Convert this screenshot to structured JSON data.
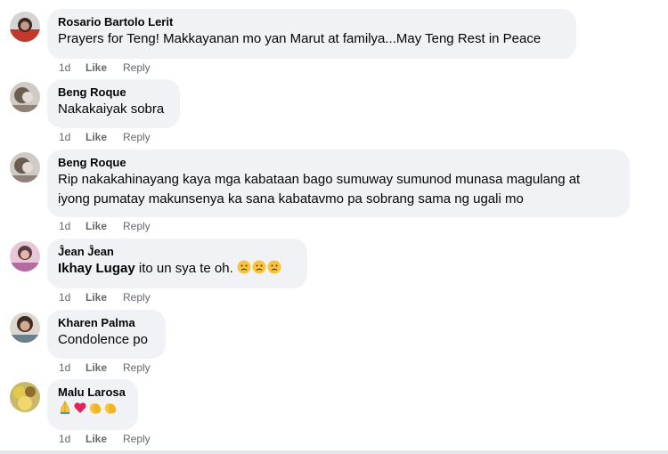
{
  "comments": [
    {
      "author": "Rosario Bartolo Lerit",
      "text": "Prayers for Teng! Makkayanan mo yan Marut at familya...May Teng Rest in Peace",
      "time": "1d",
      "like": "Like",
      "reply": "Reply"
    },
    {
      "author": "Beng Roque",
      "text": "Nakakaiyak sobra",
      "time": "1d",
      "like": "Like",
      "reply": "Reply"
    },
    {
      "author": "Beng Roque",
      "text_line1": "Rip nakakahinayang kaya mga kabataan bago sumuway sumunod munasa magulang at",
      "text_line2": "iyong pumatay makunsenya ka sana kabatavmo pa sobrang sama ng ugali mo",
      "time": "1d",
      "like": "Like",
      "reply": "Reply"
    },
    {
      "author": "Ĵean Ĵean",
      "mention": "Ikhay Lugay",
      "text": " ito un sya te oh. ",
      "emojis": [
        "sad-face-emoji",
        "sad-face-emoji",
        "sad-face-emoji"
      ],
      "time": "1d",
      "like": "Like",
      "reply": "Reply"
    },
    {
      "author": "Kharen Palma",
      "text": "Condolence po",
      "time": "1d",
      "like": "Like",
      "reply": "Reply"
    },
    {
      "author": "Malu Larosa",
      "emojis": [
        "folded-hands-emoji",
        "red-heart-emoji",
        "clapping-hands-emoji",
        "clapping-hands-emoji"
      ],
      "time": "1d",
      "like": "Like",
      "reply": "Reply"
    }
  ],
  "colors": {
    "bubble": "#f0f2f5",
    "text": "#050505",
    "meta": "#65676b",
    "heart": "#e0245e",
    "emoji_yellow": "#f7c33a"
  }
}
